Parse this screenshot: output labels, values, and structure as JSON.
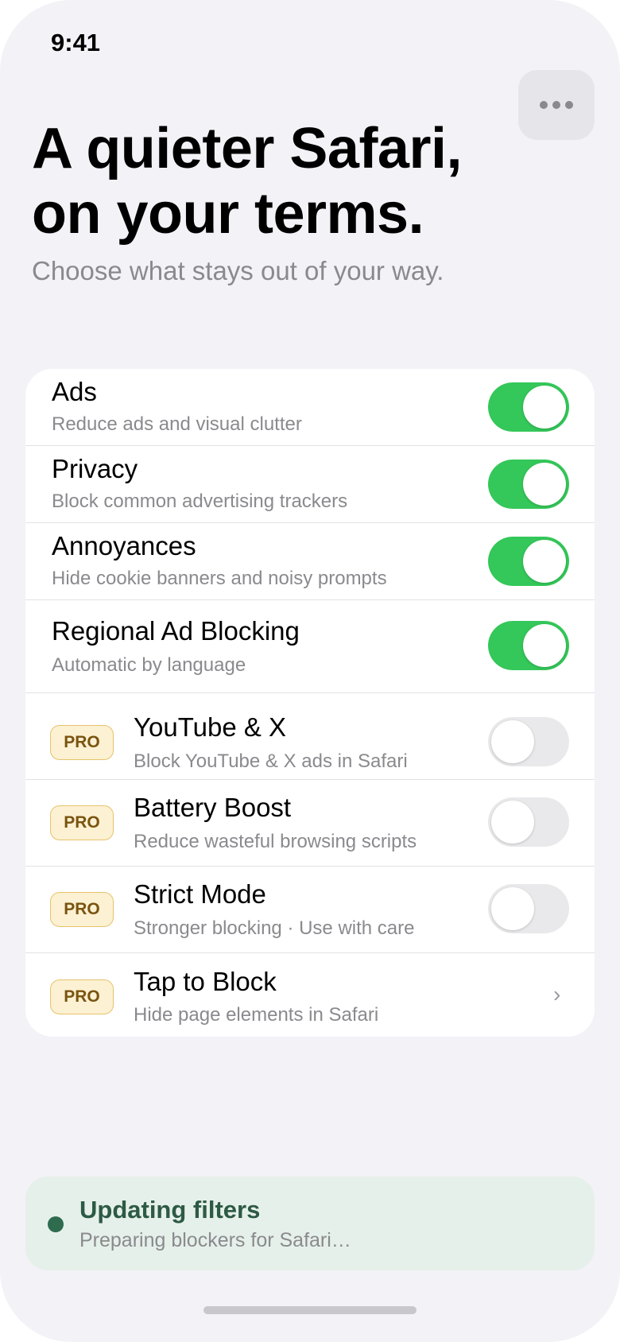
{
  "status_bar": {
    "time": "9:41"
  },
  "header": {
    "title_lines": [
      "A quieter Safari,",
      "on your terms."
    ],
    "subtitle": "Choose what stays out of your way.",
    "more_icon": "ellipsis-icon"
  },
  "filters": [
    {
      "title": "Ads",
      "subtitle": "Reduce ads and visual clutter",
      "pro": false,
      "enabled": true
    },
    {
      "title": "Privacy",
      "subtitle": "Block common advertising trackers",
      "pro": false,
      "enabled": true
    },
    {
      "title": "Annoyances",
      "subtitle": "Hide cookie banners and noisy prompts",
      "pro": false,
      "enabled": true
    },
    {
      "title": "Regional Ad Blocking",
      "subtitle": "Automatic by language",
      "pro": false,
      "enabled": true
    },
    {
      "title": "YouTube & X",
      "subtitle": "Block YouTube & X ads in Safari",
      "pro": true,
      "enabled": false
    },
    {
      "title": "Battery Boost",
      "subtitle": "Reduce wasteful browsing scripts",
      "pro": true,
      "enabled": false
    },
    {
      "title": "Strict Mode",
      "subtitle": "Stronger blocking · Use with care",
      "pro": true,
      "enabled": false
    },
    {
      "title": "Tap to Block",
      "subtitle": "Hide page elements in Safari",
      "pro": true,
      "chevron": "›"
    }
  ],
  "pro_badge_label": "PRO",
  "status_banner": {
    "title": "Updating filters",
    "subtitle": "Preparing blockers for Safari…"
  },
  "colors": {
    "toggle_on": "#34c759",
    "toggle_off": "#e9e9eb",
    "pro_badge_bg": "#fdf1d3",
    "banner_bg": "#e6f0ea",
    "banner_dot": "#2f6b4f"
  }
}
